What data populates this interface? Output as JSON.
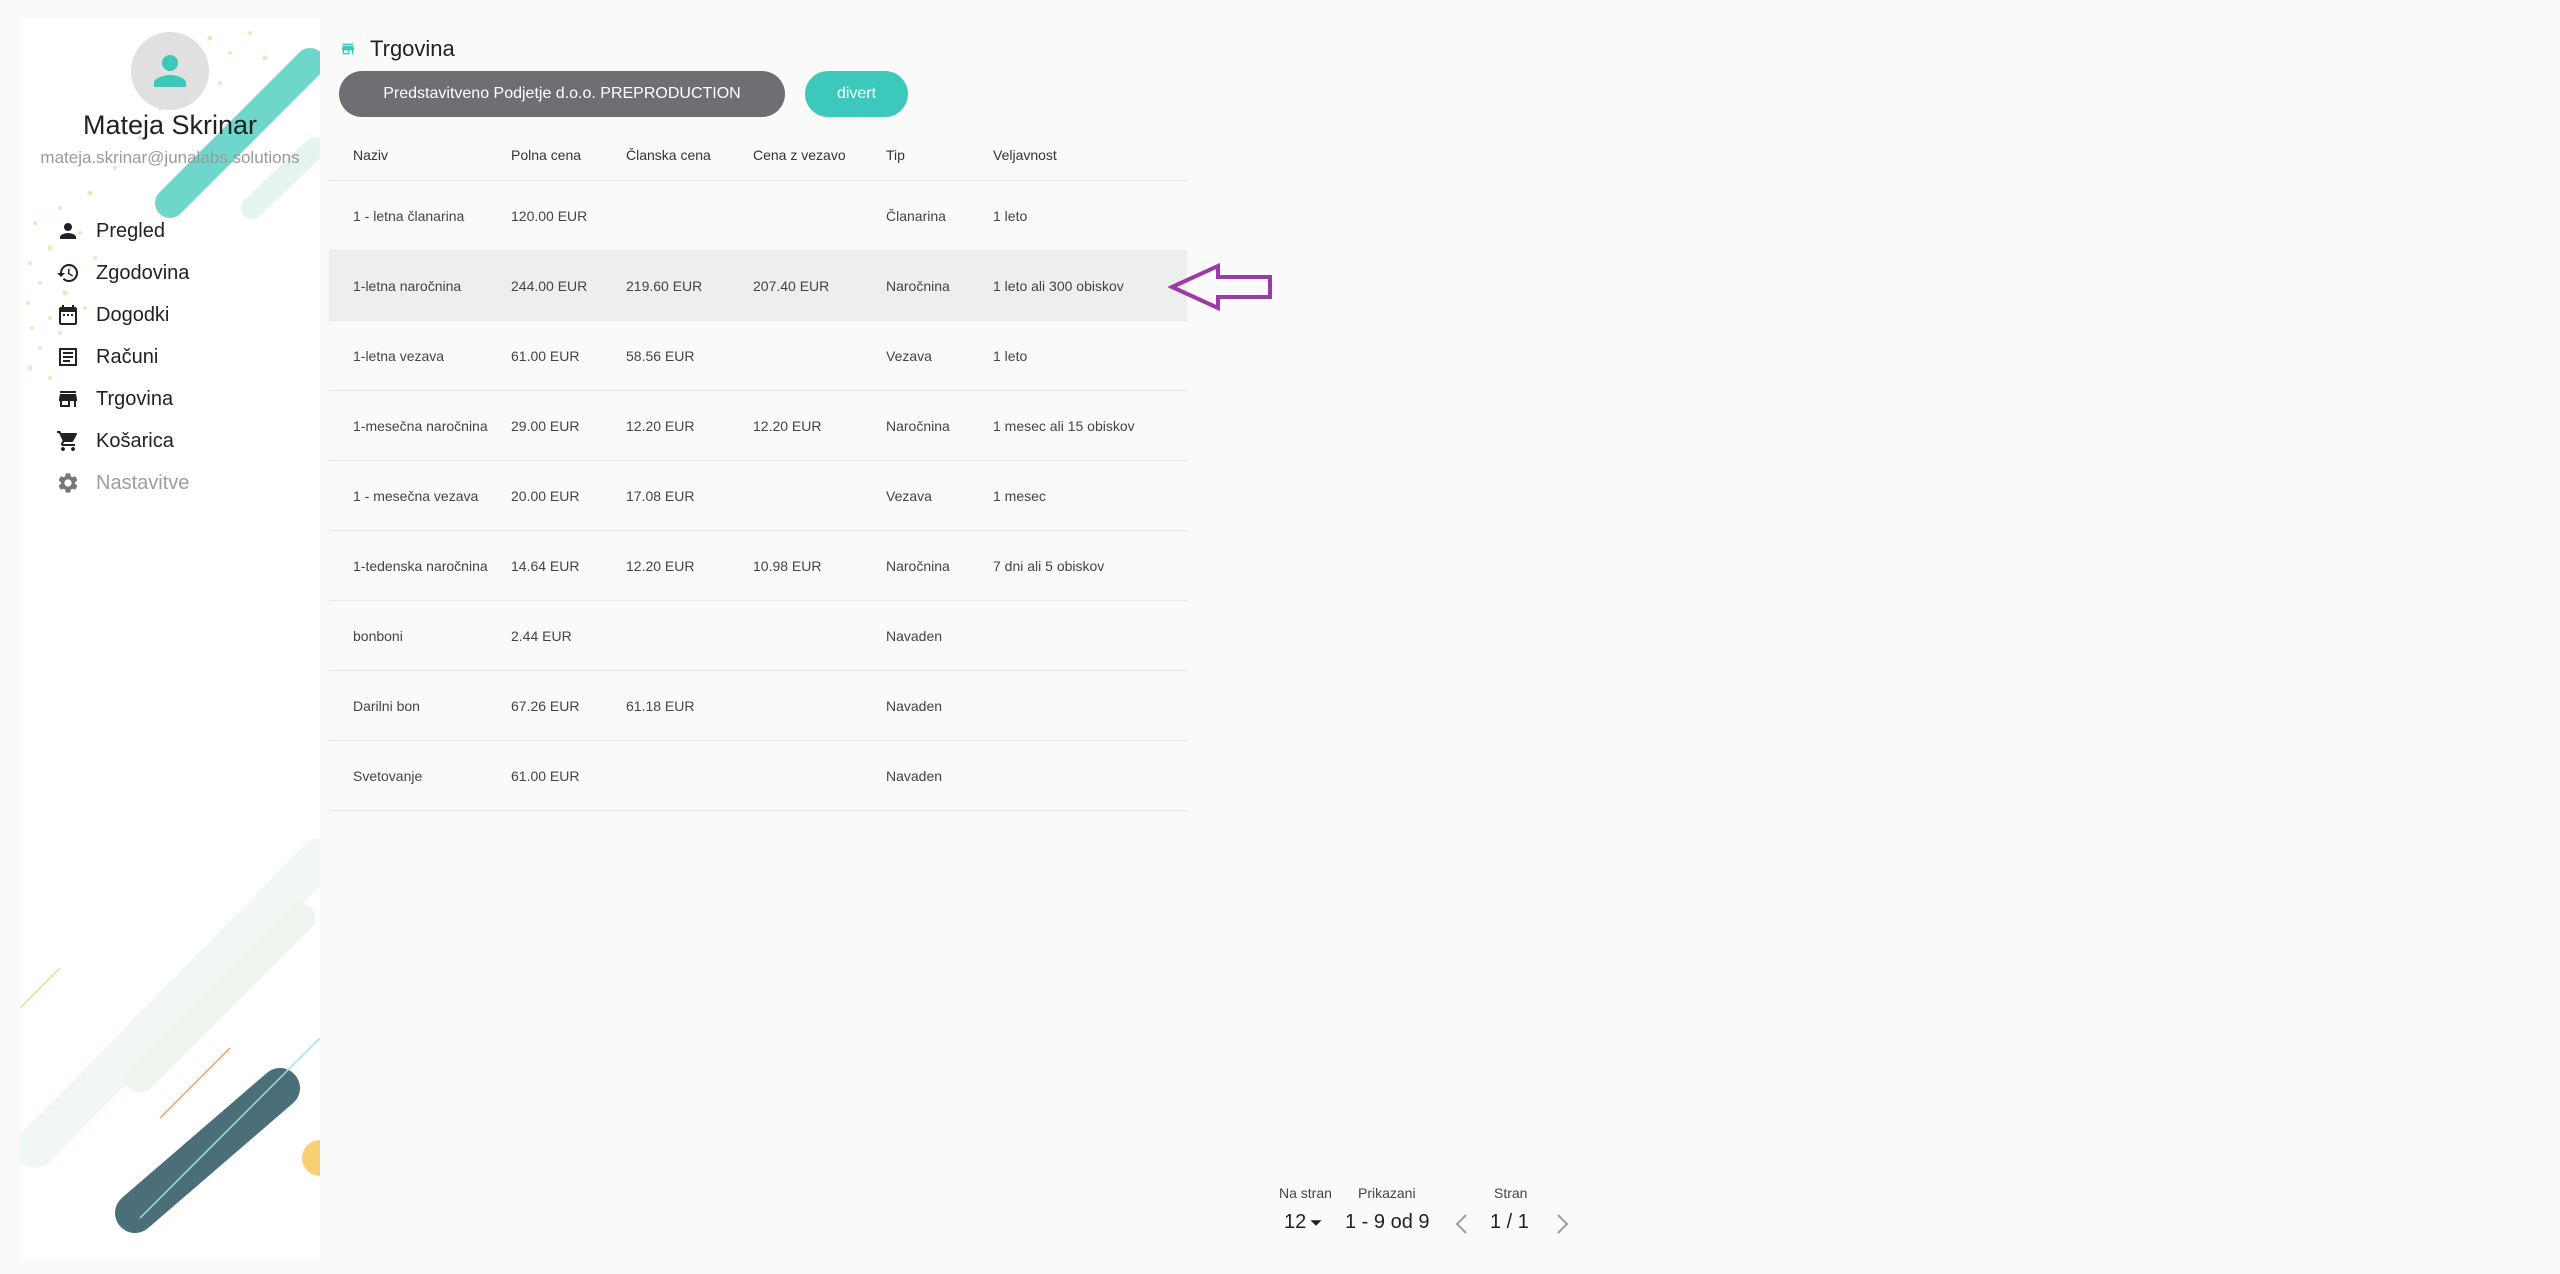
{
  "user": {
    "name": "Mateja Skrinar",
    "email": "mateja.skrinar@junalabs.solutions"
  },
  "nav": [
    {
      "label": "Pregled",
      "icon": "person-icon"
    },
    {
      "label": "Zgodovina",
      "icon": "history-icon"
    },
    {
      "label": "Dogodki",
      "icon": "calendar-icon"
    },
    {
      "label": "Računi",
      "icon": "receipt-icon"
    },
    {
      "label": "Trgovina",
      "icon": "store-icon"
    },
    {
      "label": "Košarica",
      "icon": "cart-icon"
    },
    {
      "label": "Nastavitve",
      "icon": "gear-icon"
    }
  ],
  "header": {
    "title": "Trgovina",
    "company_button": "Predstavitveno Podjetje d.o.o. PREPRODUCTION",
    "divert_button": "divert"
  },
  "table": {
    "columns": [
      "Naziv",
      "Polna cena",
      "Članska cena",
      "Cena z vezavo",
      "Tip",
      "Veljavnost"
    ],
    "rows": [
      [
        "1 - letna članarina",
        "120.00 EUR",
        "",
        "",
        "Članarina",
        "1 leto"
      ],
      [
        "1-letna naročnina",
        "244.00 EUR",
        "219.60 EUR",
        "207.40 EUR",
        "Naročnina",
        "1 leto ali 300 obiskov"
      ],
      [
        "1-letna vezava",
        "61.00 EUR",
        "58.56 EUR",
        "",
        "Vezava",
        "1 leto"
      ],
      [
        "1-mesečna naročnina",
        "29.00 EUR",
        "12.20 EUR",
        "12.20 EUR",
        "Naročnina",
        "1 mesec ali 15 obiskov"
      ],
      [
        "1 - mesečna vezava",
        "20.00 EUR",
        "17.08 EUR",
        "",
        "Vezava",
        "1 mesec"
      ],
      [
        "1-tedenska naročnina",
        "14.64 EUR",
        "12.20 EUR",
        "10.98 EUR",
        "Naročnina",
        "7 dni ali 5 obiskov"
      ],
      [
        "bonboni",
        "2.44 EUR",
        "",
        "",
        "Navaden",
        ""
      ],
      [
        "Darilni bon",
        "67.26 EUR",
        "61.18 EUR",
        "",
        "Navaden",
        ""
      ],
      [
        "Svetovanje",
        "61.00 EUR",
        "",
        "",
        "Navaden",
        ""
      ]
    ]
  },
  "paginator": {
    "per_page_label": "Na stran",
    "per_page_value": "12",
    "shown_label": "Prikazani",
    "shown_value": "1 - 9 od 9",
    "page_label": "Stran",
    "page_value": "1 / 1"
  },
  "colors": {
    "accent": "#3cc8bb",
    "company_button": "#6d6f72",
    "annotation_arrow": "#9b3aa8"
  }
}
